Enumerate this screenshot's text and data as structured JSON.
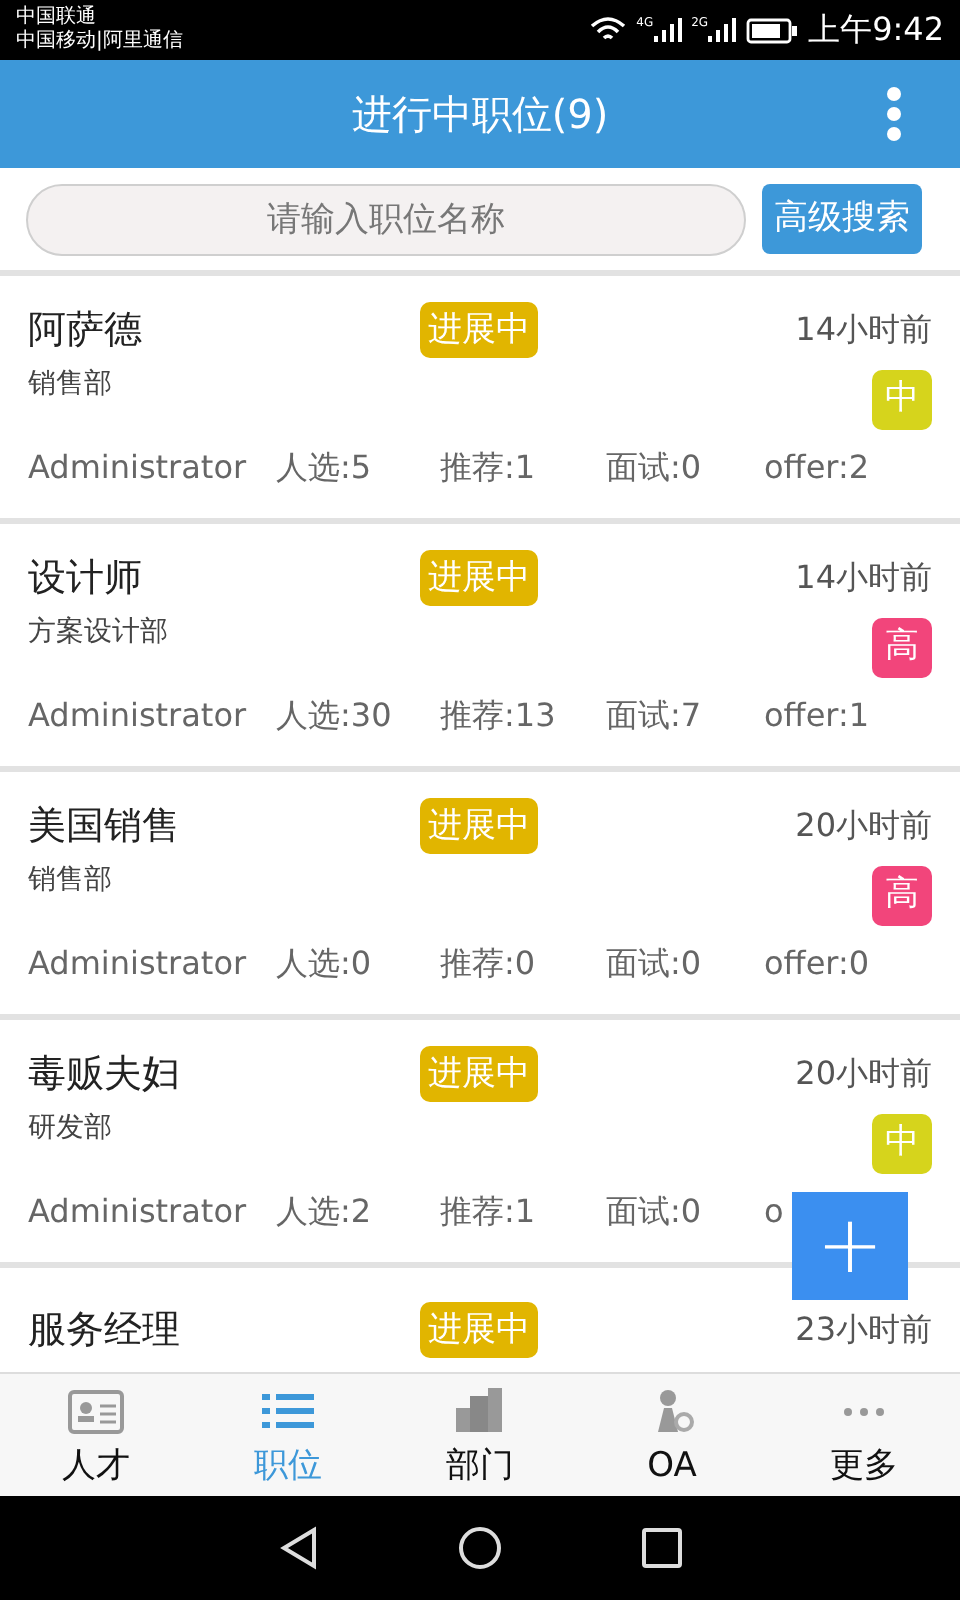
{
  "status_bar": {
    "carriers": [
      "中国联通",
      "中国移动|阿里通信"
    ],
    "network_1": "4G",
    "network_2": "2G",
    "time": "上午9:42"
  },
  "header": {
    "title": "进行中职位(9)"
  },
  "search": {
    "placeholder": "请输入职位名称",
    "button": "高级搜索"
  },
  "positions": [
    {
      "title": "阿萨德",
      "status": "进展中",
      "time": "14小时前",
      "department": "销售部",
      "priority": "中",
      "color": "#d6d41c",
      "owner": "Administrator",
      "candidates": "人选:5",
      "recommended": "推荐:1",
      "interviews": "面试:0",
      "offers": "offer:2"
    },
    {
      "title": "设计师",
      "status": "进展中",
      "time": "14小时前",
      "department": "方案设计部",
      "priority": "高",
      "color": "#f2457b",
      "owner": "Administrator",
      "candidates": "人选:30",
      "recommended": "推荐:13",
      "interviews": "面试:7",
      "offers": "offer:1"
    },
    {
      "title": "美国销售",
      "status": "进展中",
      "time": "20小时前",
      "department": "销售部",
      "priority": "高",
      "color": "#f2457b",
      "owner": "Administrator",
      "candidates": "人选:0",
      "recommended": "推荐:0",
      "interviews": "面试:0",
      "offers": "offer:0"
    },
    {
      "title": "毒贩夫妇",
      "status": "进展中",
      "time": "20小时前",
      "department": "研发部",
      "priority": "中",
      "color": "#d6d41c",
      "owner": "Administrator",
      "candidates": "人选:2",
      "recommended": "推荐:1",
      "interviews": "面试:0",
      "offers": "o"
    },
    {
      "title": "服务经理",
      "status": "进展中",
      "time": "23小时前"
    }
  ],
  "fab": {
    "label": "+"
  },
  "tabs": [
    {
      "label": "人才",
      "selected": false
    },
    {
      "label": "职位",
      "selected": true
    },
    {
      "label": "部门",
      "selected": false
    },
    {
      "label": "OA",
      "selected": false
    },
    {
      "label": "更多",
      "selected": false
    }
  ]
}
